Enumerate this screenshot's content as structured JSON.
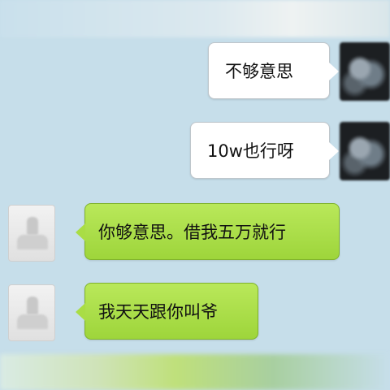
{
  "messages": [
    {
      "sender": "self",
      "text": "不够意思"
    },
    {
      "sender": "self",
      "text": "10w也行呀"
    },
    {
      "sender": "other",
      "text": "你够意思。借我五万就行"
    },
    {
      "sender": "other",
      "text": "我天天跟你叫爷"
    }
  ],
  "colors": {
    "background": "#c6deea",
    "self_bubble": "#ffffff",
    "other_bubble": "#a9dd45"
  },
  "icons": {
    "self_avatar": "blurred-photo-avatar",
    "other_avatar": "default-person-avatar"
  }
}
